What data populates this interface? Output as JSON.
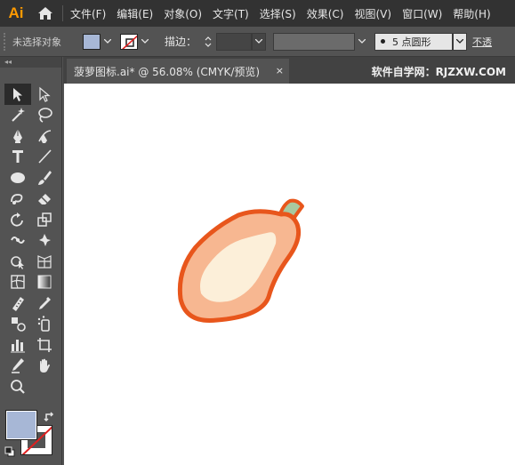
{
  "app": {
    "logo": "Ai"
  },
  "menu": [
    "文件(F)",
    "编辑(E)",
    "对象(O)",
    "文字(T)",
    "选择(S)",
    "效果(C)",
    "视图(V)",
    "窗口(W)",
    "帮助(H)"
  ],
  "control_bar": {
    "selection_status": "未选择对象",
    "fill_color": "#a7b7d6",
    "stroke_label": "描边：",
    "brush_profile": "5 点圆形",
    "opacity_label": "不透"
  },
  "tools_panel": {
    "collapse_glyph": "◂◂",
    "tools": [
      [
        "selection-tool",
        "direct-selection-tool"
      ],
      [
        "magic-wand-tool",
        "lasso-tool"
      ],
      [
        "pen-tool",
        "curvature-tool"
      ],
      [
        "type-tool",
        "line-segment-tool"
      ],
      [
        "ellipse-tool",
        "paintbrush-tool"
      ],
      [
        "shaper-tool",
        "eraser-tool"
      ],
      [
        "rotate-tool",
        "scale-tool"
      ],
      [
        "warp-tool",
        "free-transform-tool"
      ],
      [
        "shape-builder-tool",
        "perspective-grid-tool"
      ],
      [
        "mesh-tool",
        "gradient-tool"
      ],
      [
        "eyedropper-ruler-tool",
        "eyedropper-tool"
      ],
      [
        "blend-tool",
        "symbol-sprayer-tool"
      ],
      [
        "column-graph-tool",
        "artboard-tool"
      ],
      [
        "slice-tool",
        "hand-tool"
      ],
      [
        "zoom-tool",
        ""
      ]
    ],
    "fill_color": "#a7b7d6",
    "stroke_color": "#ffffff"
  },
  "document": {
    "tab_title": "菠萝图标.ai* @ 56.08% (CMYK/预览)",
    "close_glyph": "×",
    "watermark": "软件自学网：RJZXW.COM"
  },
  "artwork": {
    "outline_color": "#e8561c",
    "body_color": "#f7b791",
    "highlight_color": "#fcefd9",
    "stem_color": "#a8c9a0"
  }
}
